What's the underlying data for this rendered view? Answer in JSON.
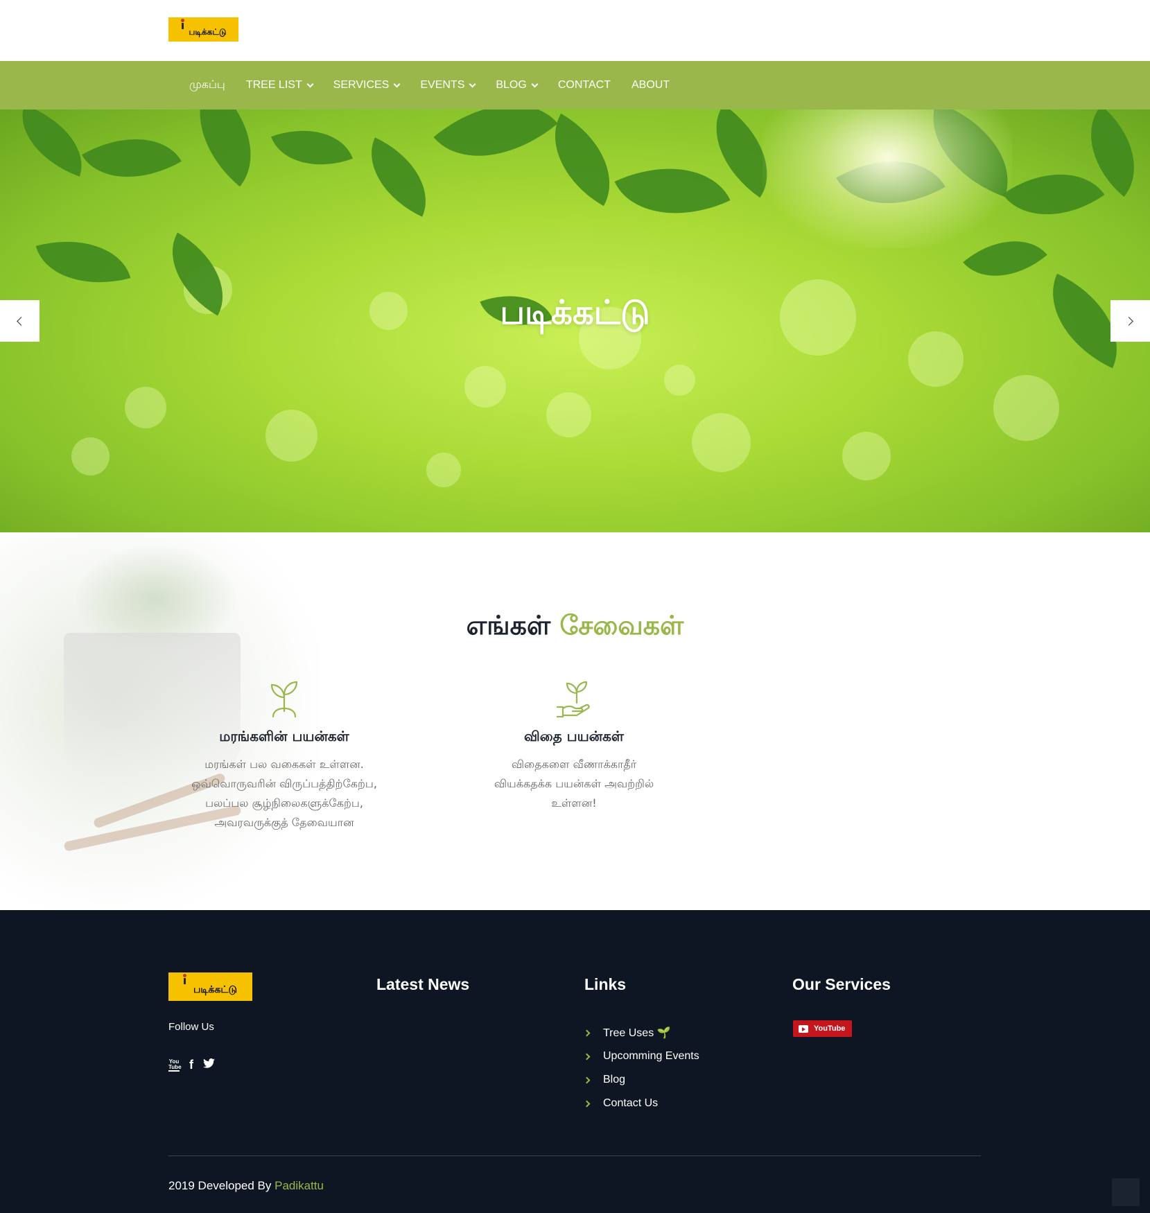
{
  "brand": {
    "logo_text": "படிக்கட்டு"
  },
  "nav": {
    "items": [
      {
        "label": "முகப்பு",
        "has_dropdown": false
      },
      {
        "label": "TREE LIST",
        "has_dropdown": true
      },
      {
        "label": "SERVICES",
        "has_dropdown": true
      },
      {
        "label": "EVENTS",
        "has_dropdown": true
      },
      {
        "label": "BLOG",
        "has_dropdown": true
      },
      {
        "label": "CONTACT",
        "has_dropdown": false
      },
      {
        "label": "ABOUT",
        "has_dropdown": false
      }
    ]
  },
  "hero": {
    "title": "படிக்கட்டு",
    "prev_icon": "chevron-left-icon",
    "next_icon": "chevron-right-icon"
  },
  "services": {
    "title_part1": "எங்கள்",
    "title_part2": "சேவைகள்",
    "cards": [
      {
        "icon": "sprout-icon",
        "title": "மரங்களின் பயன்கள்",
        "text": "மரங்கள் பல வகைகள் உள்ளன.\nஒவ்வொருவரின் விருப்பத்திற்கேற்ப,\nபலப்பல சூழ்நிலைகளுக்கேற்ப,\nஅவரவருக்குத் தேவையான"
      },
      {
        "icon": "hand-sprout-icon",
        "title": "விதை பயன்கள்",
        "text": "விதைகளை வீணாக்காதீர்\nவியக்கதக்க பயன்கள் அவற்றில்\nஉள்ளன!"
      }
    ]
  },
  "footer": {
    "follow_label": "Follow Us",
    "social_icons": [
      "youtube-icon",
      "facebook-icon",
      "twitter-icon"
    ],
    "latest_news_title": "Latest News",
    "links_title": "Links",
    "links": [
      "Tree Uses 🌱",
      "Upcomming Events",
      "Blog",
      "Contact Us"
    ],
    "services_title": "Our Services",
    "youtube_badge": "YouTube",
    "copyright_prefix": "2019 Developed By ",
    "copyright_brand": "Padikattu"
  },
  "colors": {
    "accent": "#99b74a",
    "logo_bg": "#f6c200",
    "footer_bg": "#0e1623",
    "youtube_red": "#c4161c"
  }
}
